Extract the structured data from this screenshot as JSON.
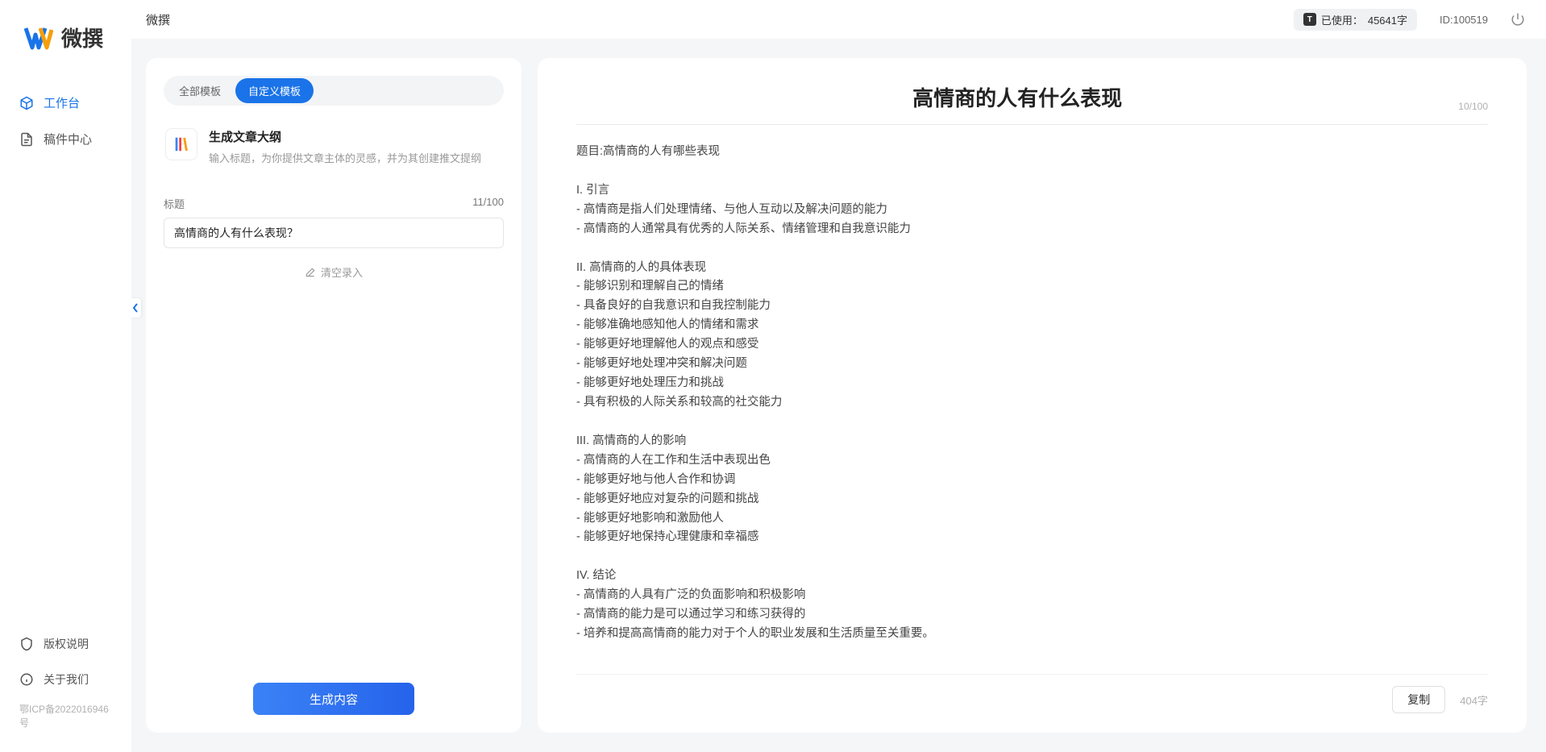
{
  "brand": "微撰",
  "sidebar": {
    "items": [
      {
        "label": "工作台"
      },
      {
        "label": "稿件中心"
      }
    ],
    "bottom": [
      {
        "label": "版权说明"
      },
      {
        "label": "关于我们"
      }
    ],
    "icp": "鄂ICP备2022016946号"
  },
  "topbar": {
    "title": "微撰",
    "usage_prefix": "已使用：",
    "usage_value": "45641字",
    "id_label": "ID:100519"
  },
  "left": {
    "tabs": [
      {
        "label": "全部模板"
      },
      {
        "label": "自定义模板"
      }
    ],
    "template": {
      "name": "生成文章大纲",
      "desc": "输入标题，为你提供文章主体的灵感，并为其创建推文提纲"
    },
    "title_field": {
      "label": "标题",
      "counter": "11/100",
      "value": "高情商的人有什么表现？"
    },
    "record_label": "清空录入",
    "generate_label": "生成内容"
  },
  "right": {
    "title": "高情商的人有什么表现",
    "title_counter": "10/100",
    "body": "题目:高情商的人有哪些表现\n\nI. 引言\n- 高情商是指人们处理情绪、与他人互动以及解决问题的能力\n- 高情商的人通常具有优秀的人际关系、情绪管理和自我意识能力\n\nII. 高情商的人的具体表现\n- 能够识别和理解自己的情绪\n- 具备良好的自我意识和自我控制能力\n- 能够准确地感知他人的情绪和需求\n- 能够更好地理解他人的观点和感受\n- 能够更好地处理冲突和解决问题\n- 能够更好地处理压力和挑战\n- 具有积极的人际关系和较高的社交能力\n\nIII. 高情商的人的影响\n- 高情商的人在工作和生活中表现出色\n- 能够更好地与他人合作和协调\n- 能够更好地应对复杂的问题和挑战\n- 能够更好地影响和激励他人\n- 能够更好地保持心理健康和幸福感\n\nIV. 结论\n- 高情商的人具有广泛的负面影响和积极影响\n- 高情商的能力是可以通过学习和练习获得的\n- 培养和提高高情商的能力对于个人的职业发展和生活质量至关重要。",
    "copy_label": "复制",
    "word_count": "404字"
  }
}
